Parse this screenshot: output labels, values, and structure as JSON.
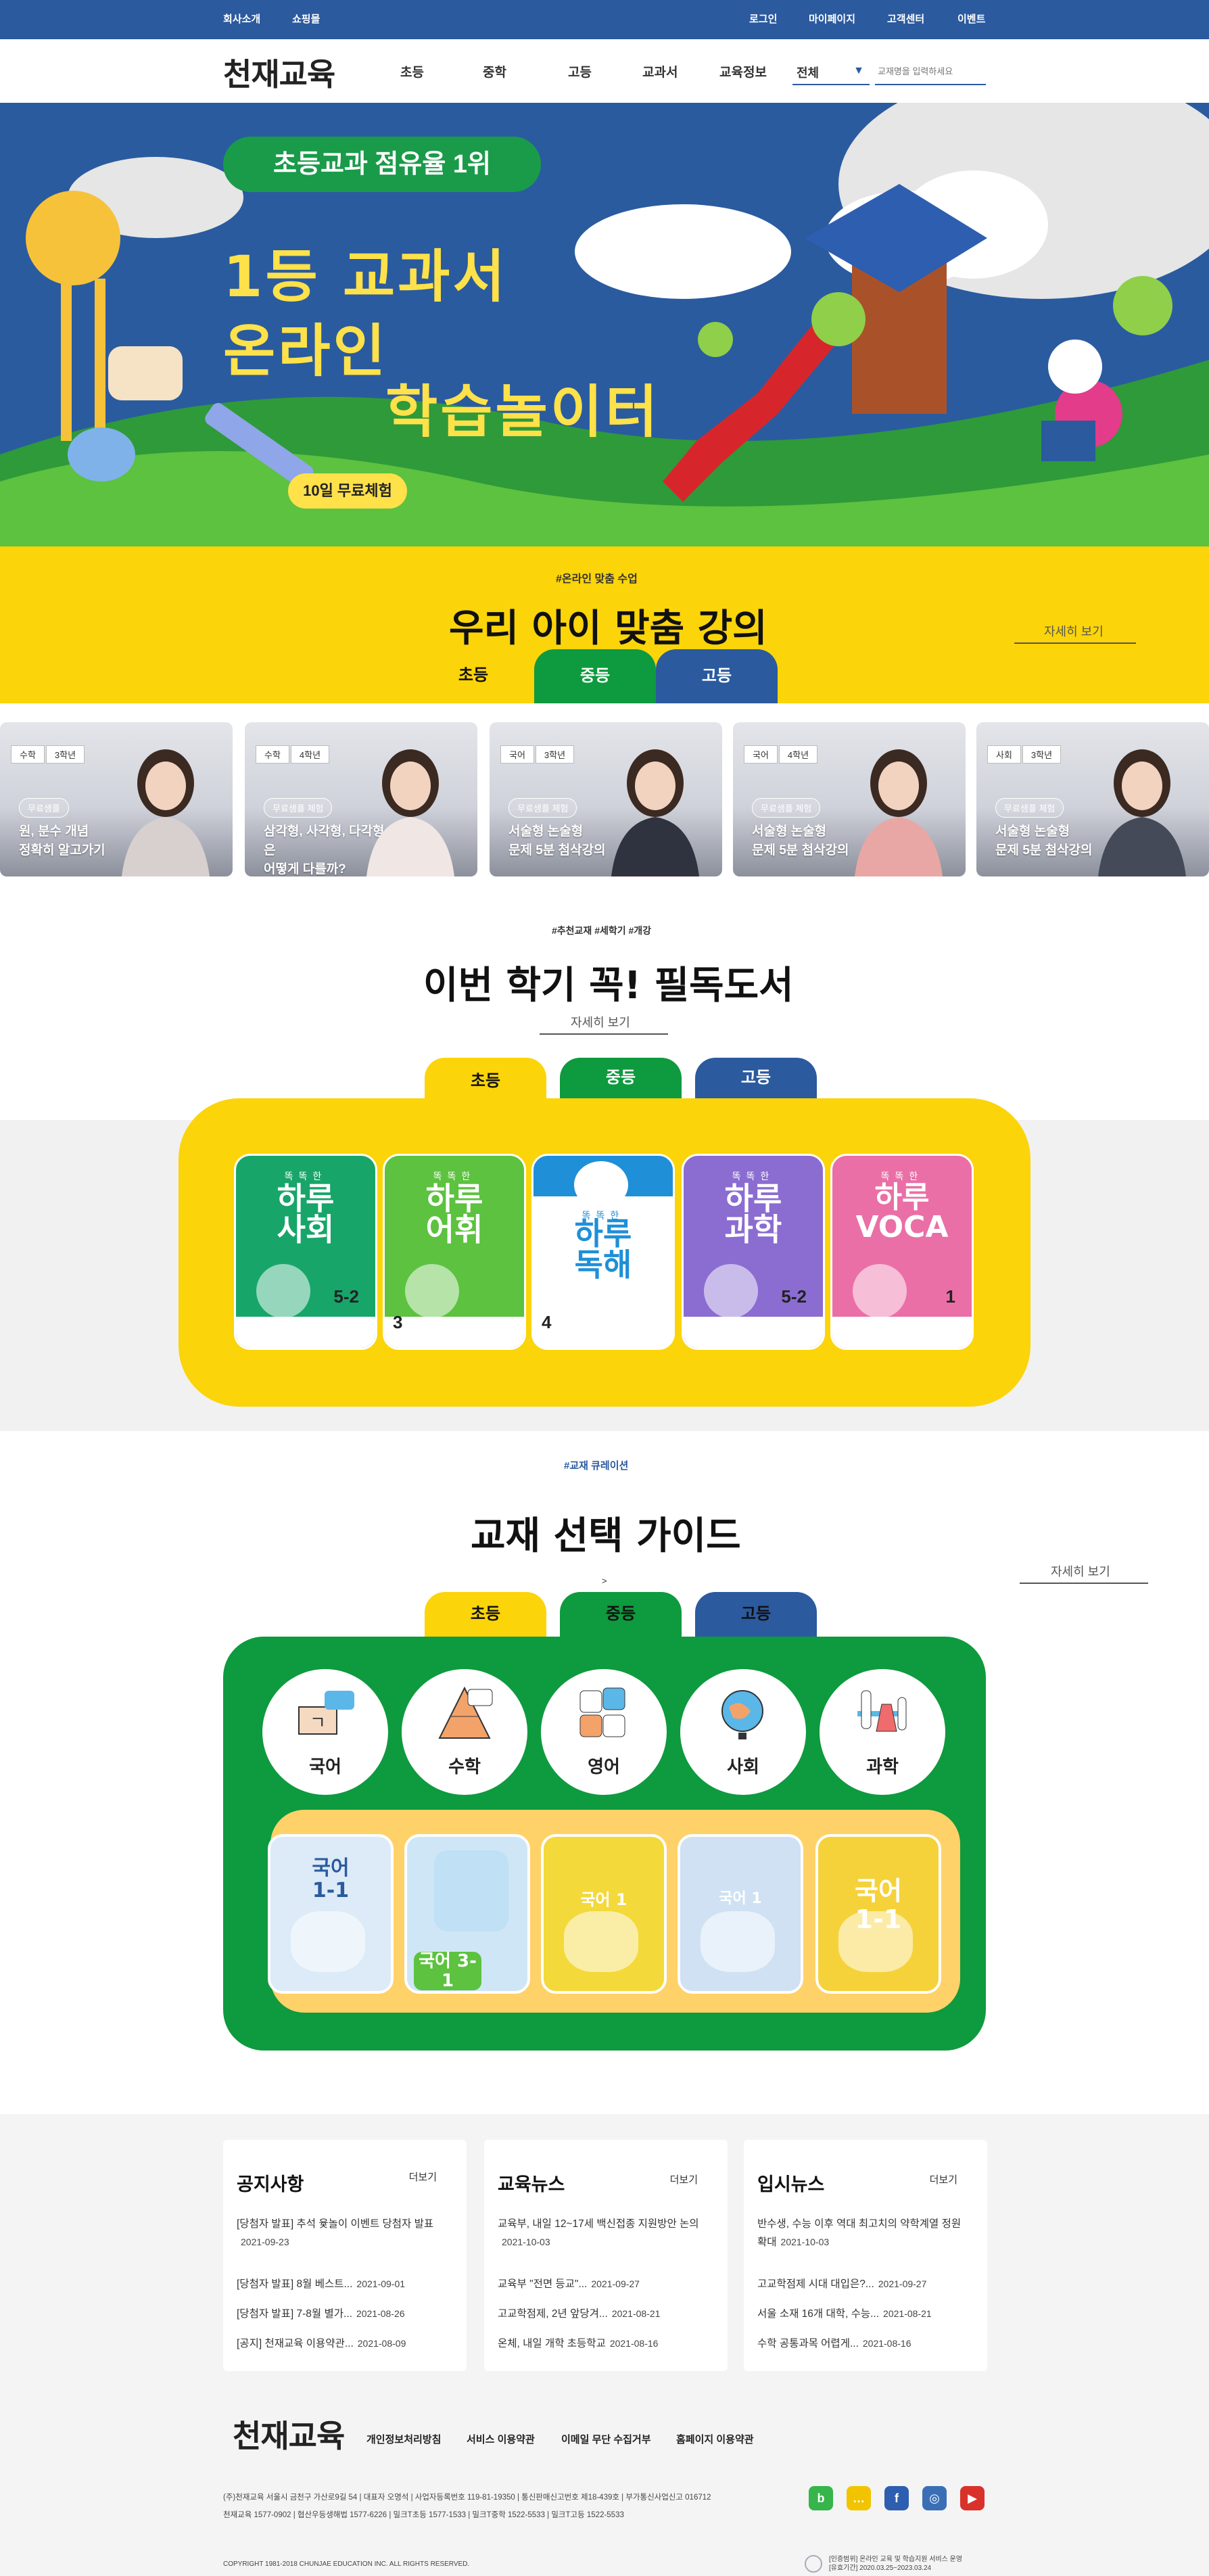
{
  "topbar": {
    "left_links": [
      "회사소개",
      "쇼핑몰"
    ],
    "right_links": [
      "로그인",
      "마이페이지",
      "고객센터",
      "이벤트"
    ]
  },
  "nav": {
    "logo": "천재교육",
    "menu": [
      "초등",
      "중학",
      "고등",
      "교과서",
      "교육정보"
    ],
    "search_select": "전체",
    "search_placeholder": "교재명을 입력하세요"
  },
  "hero": {
    "badge": "초등교과 점유율 1위",
    "line1": "1등 교과서",
    "line2": "온라인",
    "line3": "학습놀이터",
    "button": "10일 무료체험"
  },
  "lecture": {
    "hashtag": "#온라인 맞춤 수업",
    "title": "우리 아이 맞춤 강의",
    "more": "자세히 보기",
    "tabs": [
      "초등",
      "중등",
      "고등"
    ],
    "cards": [
      {
        "subject": "수학",
        "grade": "3학년",
        "pill": "무료샘플",
        "text": "원, 분수 개념\n정확히 알고가기"
      },
      {
        "subject": "수학",
        "grade": "4학년",
        "pill": "무료샘플 체험",
        "text": "삼각형, 사각형, 다각형은\n어떻게 다를까?"
      },
      {
        "subject": "국어",
        "grade": "3학년",
        "pill": "무료샘플 체험",
        "text": "서술형 논술형\n문제 5분 첨삭강의"
      },
      {
        "subject": "국어",
        "grade": "4학년",
        "pill": "무료샘플 체험",
        "text": "서술형 논술형\n문제 5분 첨삭강의"
      },
      {
        "subject": "사회",
        "grade": "3학년",
        "pill": "무료샘플 체험",
        "text": "서술형 논술형\n문제 5분 첨삭강의"
      }
    ]
  },
  "books": {
    "hashtag": "#추천교재 #세학기 #개강",
    "title": "이번 학기 꼭! 필독도서",
    "more": "자세히 보기",
    "tabs": [
      "초등",
      "중등",
      "고등"
    ],
    "items": [
      {
        "small": "똑똑한",
        "title": "하루\n사회",
        "color": "#17a56a",
        "grade": "5-2"
      },
      {
        "small": "똑똑한",
        "title": "하루\n어휘",
        "color": "#5cc23f",
        "grade": "3"
      },
      {
        "small": "똑똑한",
        "title": "하루\n독해",
        "color": "#1f8fd8",
        "grade": "4"
      },
      {
        "small": "똑똑한",
        "title": "하루\n과학",
        "color": "#8b6cd1",
        "grade": "5-2"
      },
      {
        "small": "똑똑한",
        "title": "하루\nVOCA",
        "color": "#ea6fa6",
        "grade": "1"
      }
    ]
  },
  "guide": {
    "hashtag": "#교재 큐레이션",
    "title": "교재 선택 가이드",
    "more": "자세히 보기",
    "marker": ">",
    "tabs": [
      "초등",
      "중등",
      "고등"
    ],
    "subjects": [
      {
        "label": "국어",
        "icon": "korean-book-icon"
      },
      {
        "label": "수학",
        "icon": "math-triangle-icon"
      },
      {
        "label": "영어",
        "icon": "abc-blocks-icon"
      },
      {
        "label": "사회",
        "icon": "globe-icon"
      },
      {
        "label": "과학",
        "icon": "flask-icon"
      }
    ],
    "books": [
      {
        "title": "국어\n1-1",
        "color": "#dcebf7"
      },
      {
        "title": "국어 3-1",
        "color": "#cfe6f7"
      },
      {
        "title": "국어 1",
        "color": "#f3d93a"
      },
      {
        "title": "국어 1",
        "color": "#cfe1f3"
      },
      {
        "title": "국어\n1-1",
        "color": "#f6d23a"
      }
    ]
  },
  "news": [
    {
      "heading": "공지사항",
      "more": "더보기",
      "items": [
        {
          "text": "[당첨자 발표] 추석 윷놀이 이벤트 당첨자 발표",
          "date": "2021-09-23"
        },
        {
          "text": "[당첨자 발표] 8월 베스트...",
          "date": "2021-09-01"
        },
        {
          "text": "[당첨자 발표] 7-8월 별가...",
          "date": "2021-08-26"
        },
        {
          "text": "[공지] 천재교육 이용약관...",
          "date": "2021-08-09"
        }
      ]
    },
    {
      "heading": "교육뉴스",
      "more": "더보기",
      "items": [
        {
          "text": "교육부, 내일 12~17세 백신접종 지원방안 논의",
          "date": "2021-10-03"
        },
        {
          "text": "교육부 \"전면 등교\"...",
          "date": "2021-09-27"
        },
        {
          "text": "고교학점제, 2년 앞당겨...",
          "date": "2021-08-21"
        },
        {
          "text": "온체, 내일 개학 초등학교",
          "date": "2021-08-16"
        }
      ]
    },
    {
      "heading": "입시뉴스",
      "more": "더보기",
      "items": [
        {
          "text": "반수생, 수능 이후 역대 최고치의 약학계열 정원 확대",
          "date": "2021-10-03"
        },
        {
          "text": "고교학점제 시대 대입은?...",
          "date": "2021-09-27"
        },
        {
          "text": "서울 소재 16개 대학, 수능...",
          "date": "2021-08-21"
        },
        {
          "text": "수학 공통과목 어렵게...",
          "date": "2021-08-16"
        }
      ]
    }
  ],
  "footer": {
    "logo": "천재교육",
    "links": [
      "개인정보처리방침",
      "서비스 이용약관",
      "이메일 무단 수집거부",
      "홈페이지 이용약관"
    ],
    "info1": "(주)천재교육 서울시 금천구 가산로9길 54 | 대표자 오명석 | 사업자등록번호 119-81-19350 | 통신판매신고번호 제18-439호 | 부가통신사업신고 016712",
    "info2": "천재교육 1577-0902 | 협산우등생해법 1577-6226 | 밀크T초등 1577-1533 | 밀크T중학 1522-5533 | 밀크T고등 1522-5533",
    "copyright": "COPYRIGHT 1981-2018 CHUNJAE EDUCATION INC. ALL RIGHTS RESERVED.",
    "cert": "[인증범위] 온라인 교육 및 학습지원 서비스 운영\n[유효기간] 2020.03.25~2023.03.24",
    "sns": [
      {
        "icon": "blog-icon",
        "glyph": "b",
        "color": "#35b54a"
      },
      {
        "icon": "kakaotalk-icon",
        "glyph": "…",
        "color": "#f2c400"
      },
      {
        "icon": "facebook-icon",
        "glyph": "f",
        "color": "#2e5eb0"
      },
      {
        "icon": "instagram-icon",
        "glyph": "◎",
        "color": "#3a6fb6"
      },
      {
        "icon": "youtube-icon",
        "glyph": "▶",
        "color": "#d9322a"
      }
    ]
  }
}
